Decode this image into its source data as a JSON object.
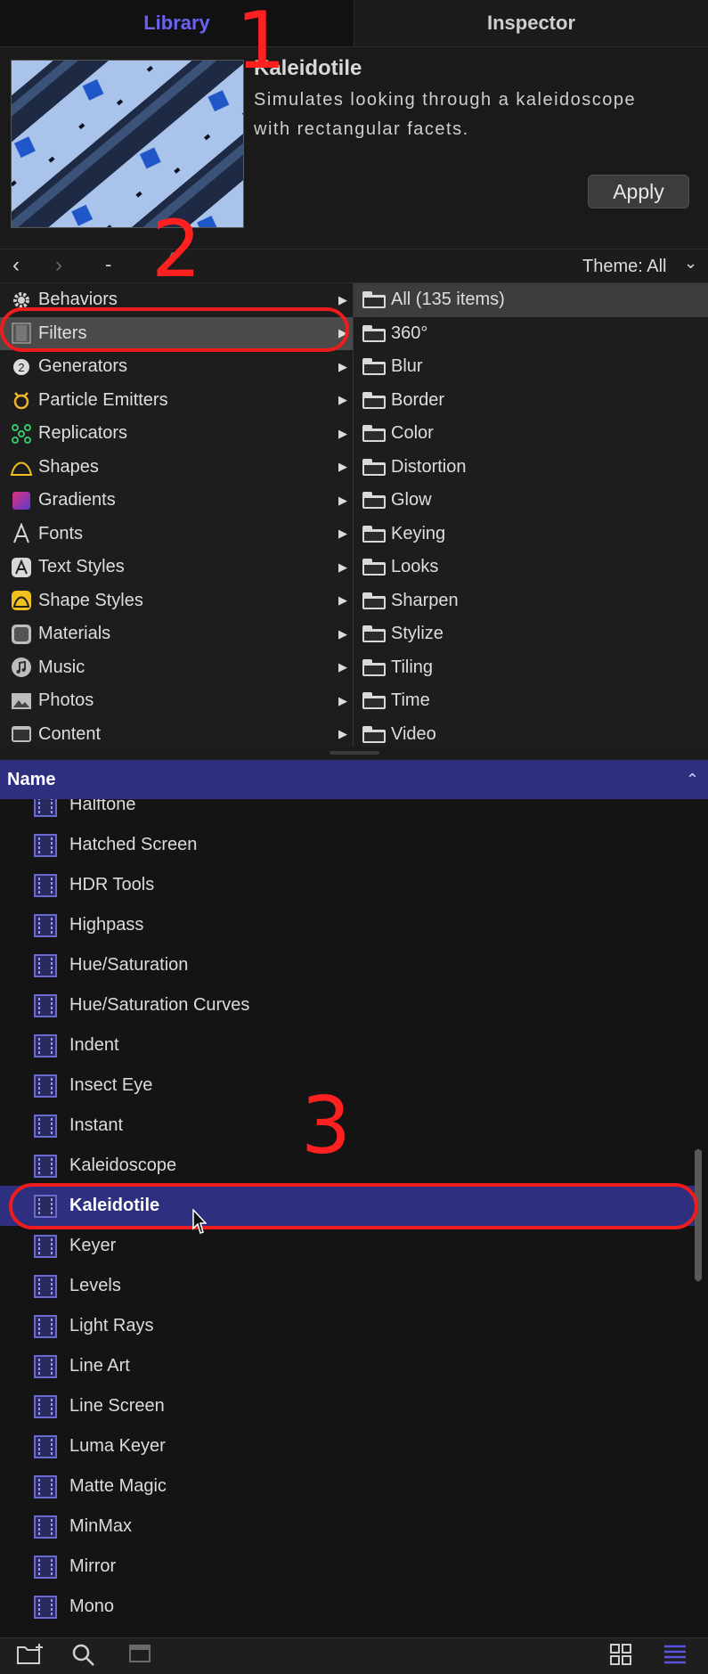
{
  "tabs": {
    "library": "Library",
    "inspector": "Inspector"
  },
  "preview": {
    "title": "Kaleidotile",
    "description": "Simulates looking through a kaleidoscope with rectangular facets.",
    "apply_label": "Apply"
  },
  "nav": {
    "back": "‹",
    "forward": "›",
    "dash": "-",
    "caret": "^",
    "theme": "Theme: All",
    "theme_chevron": "⌄"
  },
  "categories": [
    {
      "label": "Behaviors",
      "icon": "gear-icon"
    },
    {
      "label": "Filters",
      "icon": "filmstrip-icon"
    },
    {
      "label": "Generators",
      "icon": "generator-icon"
    },
    {
      "label": "Particle Emitters",
      "icon": "particle-emitter-icon"
    },
    {
      "label": "Replicators",
      "icon": "replicator-icon"
    },
    {
      "label": "Shapes",
      "icon": "shape-icon"
    },
    {
      "label": "Gradients",
      "icon": "gradient-icon"
    },
    {
      "label": "Fonts",
      "icon": "font-icon"
    },
    {
      "label": "Text Styles",
      "icon": "text-style-icon"
    },
    {
      "label": "Shape Styles",
      "icon": "shape-style-icon"
    },
    {
      "label": "Materials",
      "icon": "material-icon"
    },
    {
      "label": "Music",
      "icon": "music-icon"
    },
    {
      "label": "Photos",
      "icon": "photo-icon"
    },
    {
      "label": "Content",
      "icon": "content-icon"
    }
  ],
  "folders": [
    "All (135 items)",
    "360°",
    "Blur",
    "Border",
    "Color",
    "Distortion",
    "Glow",
    "Keying",
    "Looks",
    "Sharpen",
    "Stylize",
    "Tiling",
    "Time",
    "Video"
  ],
  "list_header": "Name",
  "list_items": [
    "Halftone",
    "Hatched Screen",
    "HDR Tools",
    "Highpass",
    "Hue/Saturation",
    "Hue/Saturation Curves",
    "Indent",
    "Insect Eye",
    "Instant",
    "Kaleidoscope",
    "Kaleidotile",
    "Keyer",
    "Levels",
    "Light Rays",
    "Line Art",
    "Line Screen",
    "Luma Keyer",
    "Matte Magic",
    "MinMax",
    "Mirror",
    "Mono"
  ],
  "selected_item": "Kaleidotile",
  "annotations": [
    "1",
    "2",
    "3"
  ],
  "colors": {
    "accent": "#6a62f0",
    "selection": "#2e2f7f",
    "annotation": "#ee1c1c"
  }
}
